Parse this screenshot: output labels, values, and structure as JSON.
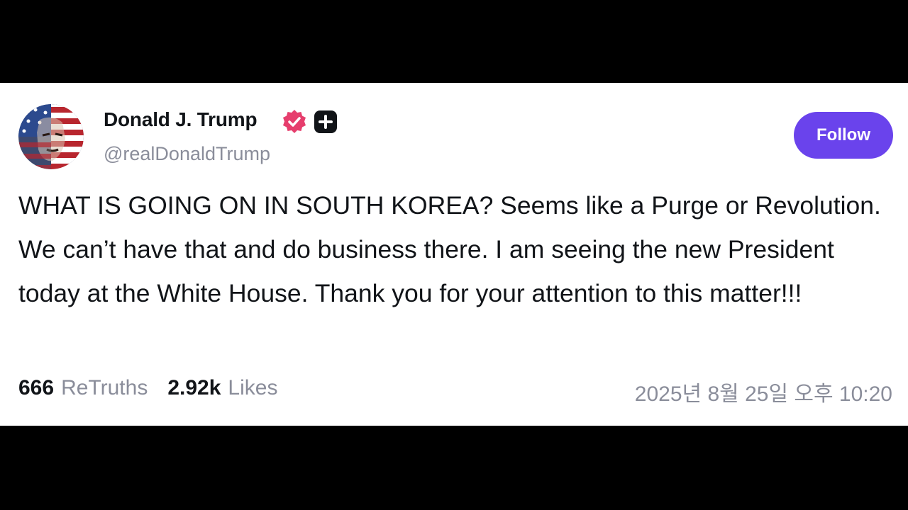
{
  "author": {
    "name": "Donald J. Trump",
    "handle": "@realDonaldTrump",
    "verified_icon": "verified-badge-icon",
    "plus_icon": "plus-badge-icon",
    "avatar_icon": "flag-portrait-avatar"
  },
  "actions": {
    "follow_label": "Follow"
  },
  "post": {
    "text": "WHAT IS GOING ON IN SOUTH KOREA? Seems like a Purge or Revolution. We can’t have that and do business there. I am seeing the new President today at the White House. Thank you for your attention to this matter!!!"
  },
  "stats": {
    "retruths_count": "666",
    "retruths_label": "ReTruths",
    "likes_count": "2.92k",
    "likes_label": "Likes"
  },
  "timestamp": "2025년 8월 25일 오후 10:20",
  "colors": {
    "follow_button": "#6a43ec",
    "verified_badge": "#e63e6d",
    "text_primary": "#111418",
    "text_secondary": "#8a8d9a"
  }
}
